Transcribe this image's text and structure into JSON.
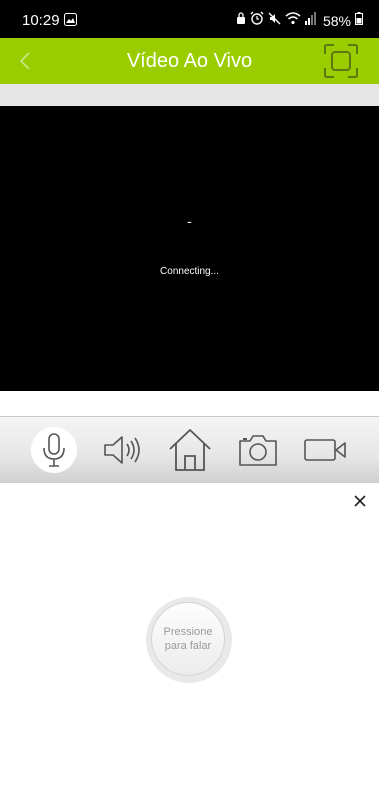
{
  "status_bar": {
    "time": "10:29",
    "battery": "58%"
  },
  "header": {
    "title": "Vídeo Ao Vivo"
  },
  "video": {
    "placeholder": "-",
    "status": "Connecting..."
  },
  "toolbar": {
    "items": [
      "microphone-icon",
      "speaker-icon",
      "home-icon",
      "camera-icon",
      "video-record-icon"
    ]
  },
  "talk": {
    "label": "Pressione para falar"
  },
  "colors": {
    "header_bg": "#9ACD00",
    "video_bg": "#000000",
    "toolbar_bg": "#E6E6E6"
  }
}
